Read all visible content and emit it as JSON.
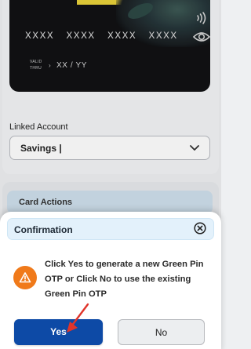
{
  "card": {
    "number": "XXXX XXXX XXXX XXXX",
    "valid_thru_label": "VALID\nTHRU",
    "valid_arrow": "›",
    "expiry": "XX / YY"
  },
  "linked_account": {
    "label": "Linked Account",
    "selected": "Savings |"
  },
  "card_actions": {
    "title": "Card Actions"
  },
  "dialog": {
    "title": "Confirmation",
    "message": "Click Yes to generate a new Green Pin OTP or Click No to use the existing Green Pin OTP",
    "yes_label": "Yes",
    "no_label": "No"
  },
  "colors": {
    "primary": "#0d4aa6",
    "warning": "#f07a1a",
    "header_tint": "#e3f1fb",
    "annotation_arrow": "#e0342a"
  }
}
